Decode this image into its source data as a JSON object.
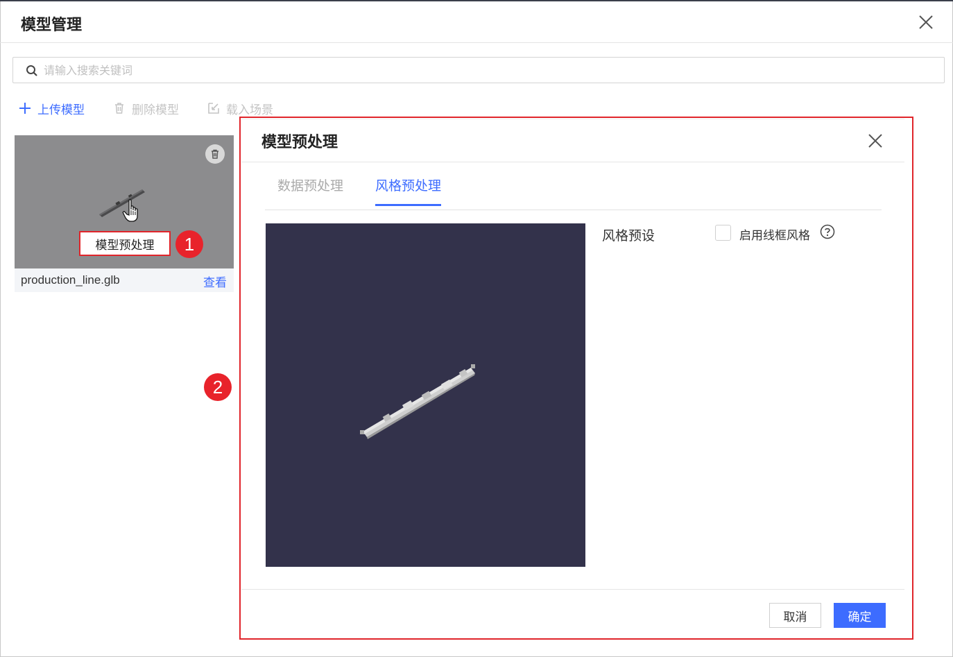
{
  "main": {
    "title": "模型管理",
    "search_placeholder": "请输入搜索关键词",
    "toolbar": {
      "upload": "上传模型",
      "delete": "删除模型",
      "load_scene": "载入场景"
    },
    "card": {
      "preprocess_label": "模型预处理",
      "file_name": "production_line.glb",
      "view_label": "查看"
    }
  },
  "annotations": {
    "badge_1": "1",
    "badge_2": "2"
  },
  "dialog": {
    "title": "模型预处理",
    "tabs": [
      {
        "label": "数据预处理",
        "active": false
      },
      {
        "label": "风格预处理",
        "active": true
      }
    ],
    "style_preset_label": "风格预设",
    "wireframe_label": "启用线框风格",
    "wireframe_checked": false,
    "cancel_label": "取消",
    "confirm_label": "确定"
  },
  "colors": {
    "accent": "#3d6cff",
    "annotation_red": "#e0242a",
    "preview_bg": "#33324b",
    "thumb_bg": "#8c8c8e"
  },
  "icons": [
    "search-icon",
    "close-icon",
    "plus-icon",
    "trash-icon",
    "import-icon",
    "hand-cursor-icon",
    "help-icon"
  ]
}
